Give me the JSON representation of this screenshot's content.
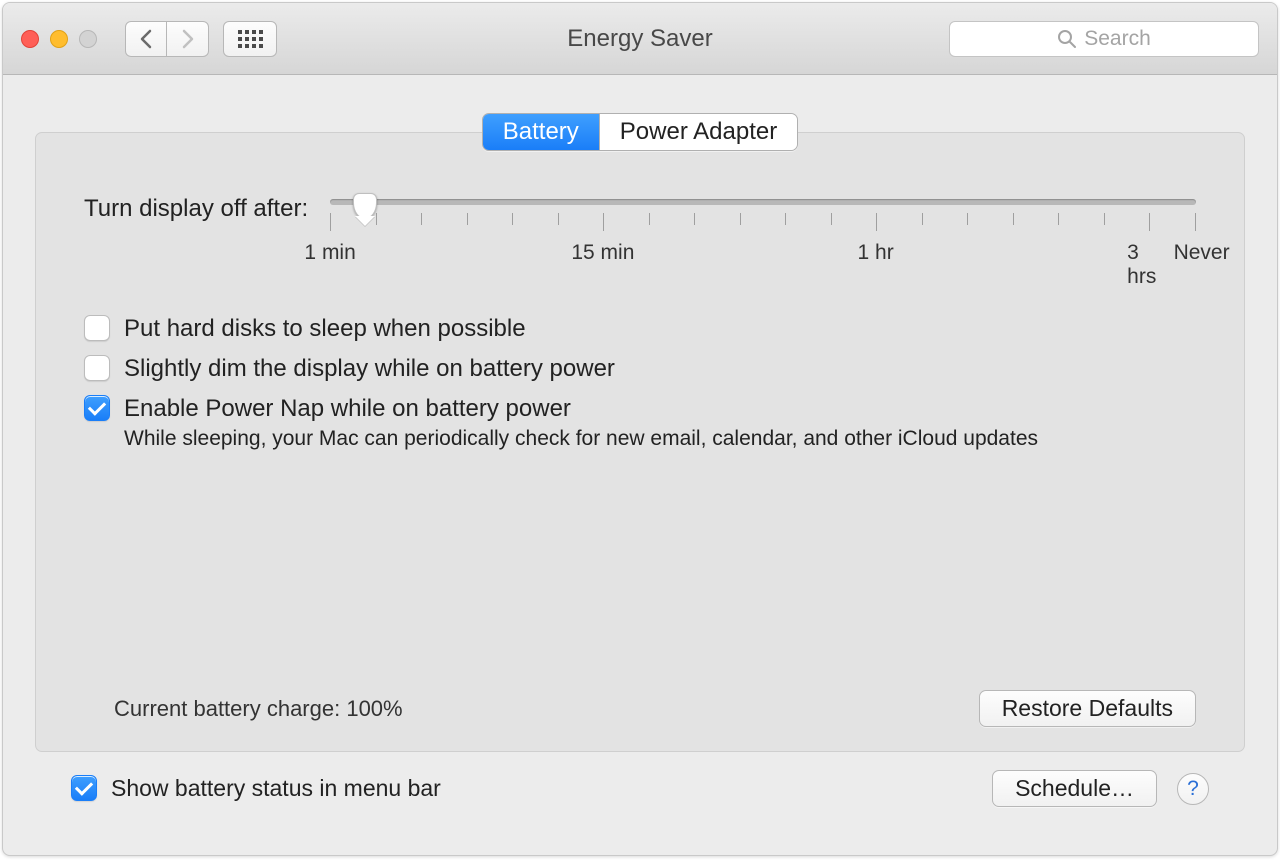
{
  "window": {
    "title": "Energy Saver"
  },
  "search": {
    "placeholder": "Search"
  },
  "tabs": {
    "battery": "Battery",
    "power_adapter": "Power Adapter"
  },
  "slider": {
    "label": "Turn display off after:",
    "tick_labels": {
      "min1": "1 min",
      "min15": "15 min",
      "hr1": "1 hr",
      "hr3": "3 hrs",
      "never": "Never"
    }
  },
  "checks": {
    "hard_disks": "Put hard disks to sleep when possible",
    "dim_display": "Slightly dim the display while on battery power",
    "power_nap": "Enable Power Nap while on battery power",
    "power_nap_desc": "While sleeping, your Mac can periodically check for new email, calendar, and other iCloud updates"
  },
  "status": {
    "charge": "Current battery charge: 100%"
  },
  "buttons": {
    "restore": "Restore Defaults",
    "schedule": "Schedule…"
  },
  "footer": {
    "menu_bar": "Show battery status in menu bar"
  },
  "help": "?"
}
